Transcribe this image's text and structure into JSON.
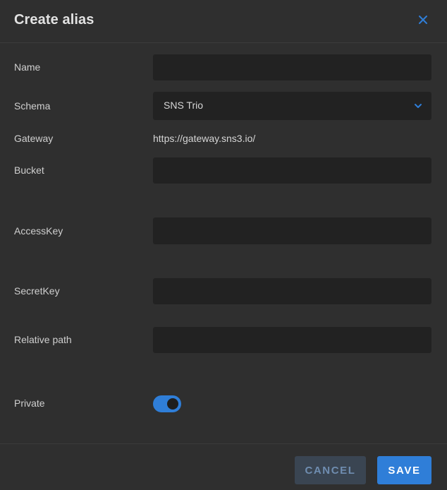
{
  "dialog": {
    "title": "Create alias"
  },
  "form": {
    "name": {
      "label": "Name",
      "value": ""
    },
    "schema": {
      "label": "Schema",
      "value": "SNS Trio"
    },
    "gateway": {
      "label": "Gateway",
      "value": "https://gateway.sns3.io/"
    },
    "bucket": {
      "label": "Bucket",
      "value": ""
    },
    "access_key": {
      "label": "AccessKey",
      "value": ""
    },
    "secret_key": {
      "label": "SecretKey",
      "value": ""
    },
    "relative_path": {
      "label": "Relative path",
      "value": ""
    },
    "private": {
      "label": "Private",
      "checked": true
    }
  },
  "actions": {
    "cancel_label": "CANCEL",
    "save_label": "SAVE"
  },
  "icons": {
    "close": "close-icon",
    "chevron": "chevron-down-icon"
  },
  "colors": {
    "background": "#2f2f2f",
    "field_background": "#222222",
    "accent": "#2f7ed8",
    "cancel_background": "#3a4552",
    "cancel_text": "#6f8db0"
  }
}
